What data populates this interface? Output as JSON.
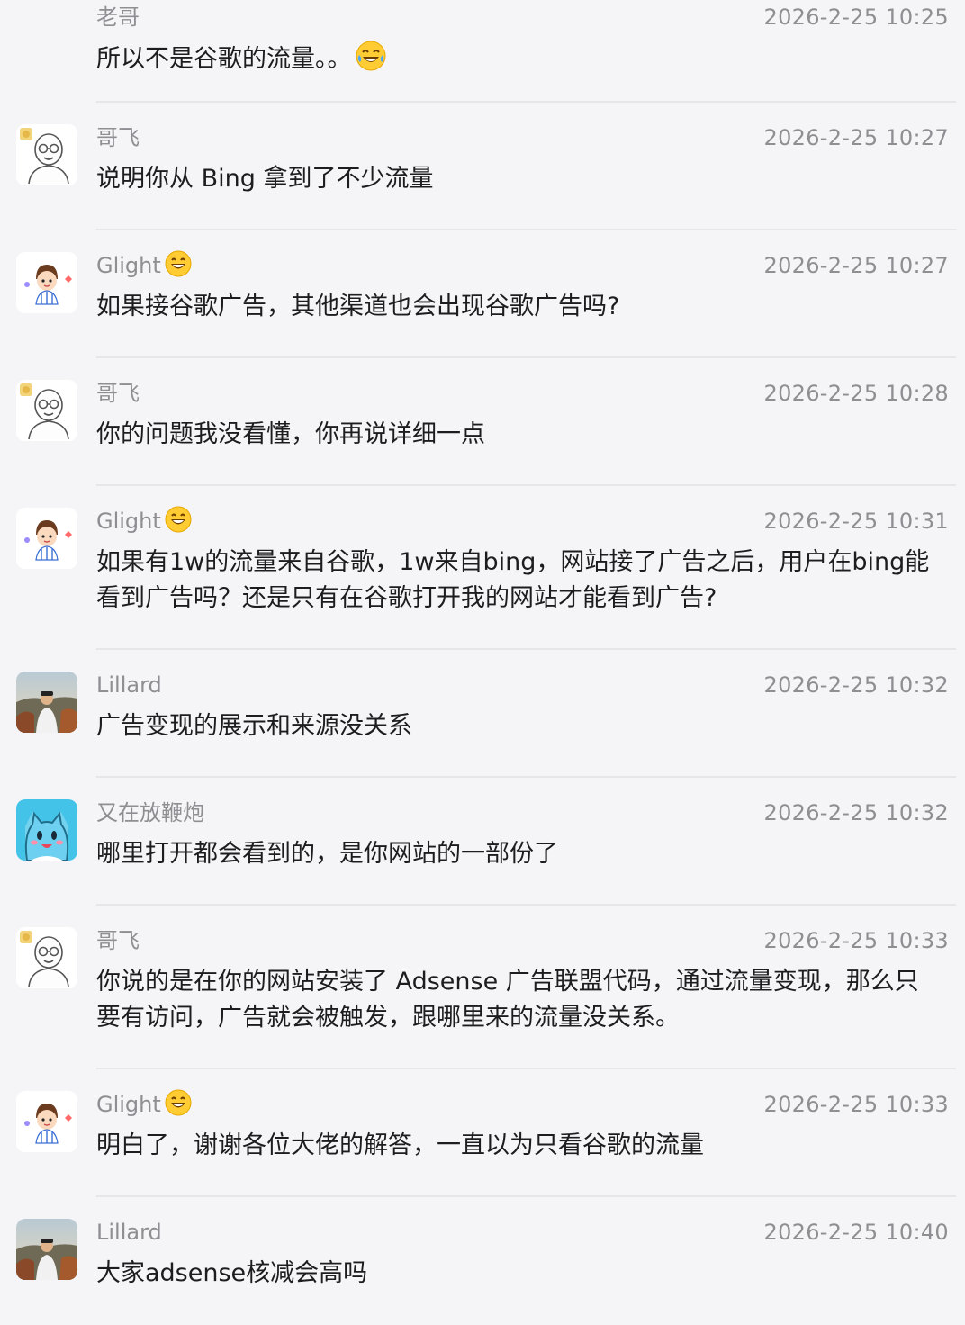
{
  "messages": [
    {
      "author": "老哥",
      "time": "2026-2-25 10:25",
      "text": "所以不是谷歌的流量。。",
      "avatar_icon": "none",
      "text_emoji": "laughing-crying-emoji"
    },
    {
      "author": "哥飞",
      "time": "2026-2-25 10:27",
      "text": "说明你从 Bing 拿到了不少流量",
      "avatar_icon": "bald-glasses-man-avatar"
    },
    {
      "author": "Glight",
      "author_emoji": "grinning-face-emoji",
      "time": "2026-2-25 10:27",
      "text": "如果接谷歌广告，其他渠道也会出现谷歌广告吗?",
      "avatar_icon": "cartoon-boy-avatar"
    },
    {
      "author": "哥飞",
      "time": "2026-2-25 10:28",
      "text": "你的问题我没看懂，你再说详细一点",
      "avatar_icon": "bald-glasses-man-avatar"
    },
    {
      "author": "Glight",
      "author_emoji": "grinning-face-emoji",
      "time": "2026-2-25 10:31",
      "text": "如果有1w的流量来自谷歌，1w来自bing，网站接了广告之后，用户在bing能看到广告吗？还是只有在谷歌打开我的网站才能看到广告?",
      "avatar_icon": "cartoon-boy-avatar"
    },
    {
      "author": "Lillard",
      "time": "2026-2-25 10:32",
      "text": "广告变现的展示和来源没关系",
      "avatar_icon": "photo-person-avatar"
    },
    {
      "author": "又在放鞭炮",
      "time": "2026-2-25 10:32",
      "text": "哪里打开都会看到的，是你网站的一部份了",
      "avatar_icon": "blue-cat-avatar"
    },
    {
      "author": "哥飞",
      "time": "2026-2-25 10:33",
      "text": "你说的是在你的网站安装了 Adsense 广告联盟代码，通过流量变现，那么只要有访问，广告就会被触发，跟哪里来的流量没关系。",
      "avatar_icon": "bald-glasses-man-avatar"
    },
    {
      "author": "Glight",
      "author_emoji": "grinning-face-emoji",
      "time": "2026-2-25 10:33",
      "text": "明白了，谢谢各位大佬的解答，一直以为只看谷歌的流量",
      "avatar_icon": "cartoon-boy-avatar"
    },
    {
      "author": "Lillard",
      "time": "2026-2-25 10:40",
      "text": "大家adsense核减会高吗",
      "avatar_icon": "photo-person-avatar"
    }
  ]
}
